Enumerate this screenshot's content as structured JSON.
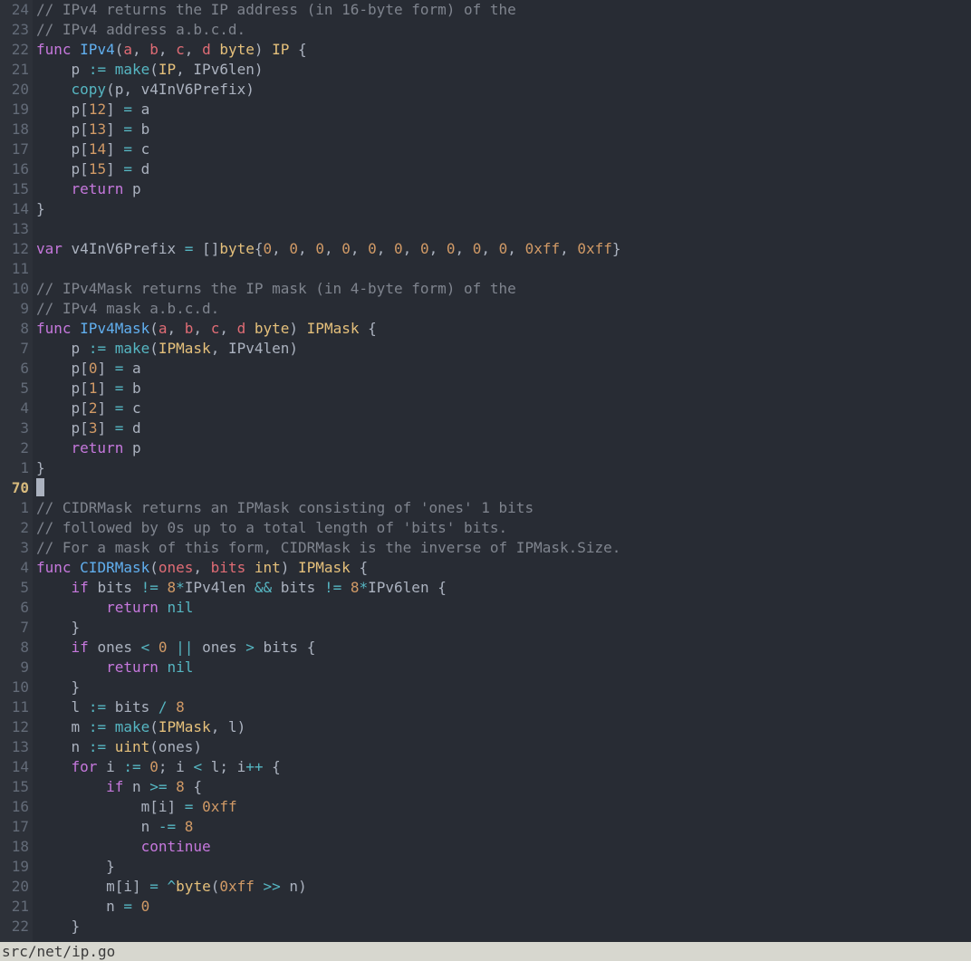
{
  "statusbar": {
    "path": "src/net/ip.go"
  },
  "vim": {
    "current_absolute_line": "70"
  },
  "gutter": [
    "24",
    "23",
    "22",
    "21",
    "20",
    "19",
    "18",
    "17",
    "16",
    "15",
    "14",
    "13",
    "12",
    "11",
    "10",
    "9",
    "8",
    "7",
    "6",
    "5",
    "4",
    "3",
    "2",
    "1",
    "70",
    "1",
    "2",
    "3",
    "4",
    "5",
    "6",
    "7",
    "8",
    "9",
    "10",
    "11",
    "12",
    "13",
    "14",
    "15",
    "16",
    "17",
    "18",
    "19",
    "20",
    "21",
    "22"
  ],
  "lines": [
    [
      {
        "c": "cmt",
        "t": "// IPv4 returns the IP address (in 16-byte form) of the"
      }
    ],
    [
      {
        "c": "cmt",
        "t": "// IPv4 address a.b.c.d."
      }
    ],
    [
      {
        "c": "kw",
        "t": "func"
      },
      {
        "c": "pun",
        "t": " "
      },
      {
        "c": "fn",
        "t": "IPv4"
      },
      {
        "c": "pun",
        "t": "("
      },
      {
        "c": "param",
        "t": "a"
      },
      {
        "c": "pun",
        "t": ", "
      },
      {
        "c": "param",
        "t": "b"
      },
      {
        "c": "pun",
        "t": ", "
      },
      {
        "c": "param",
        "t": "c"
      },
      {
        "c": "pun",
        "t": ", "
      },
      {
        "c": "param",
        "t": "d"
      },
      {
        "c": "pun",
        "t": " "
      },
      {
        "c": "typ",
        "t": "byte"
      },
      {
        "c": "pun",
        "t": ") "
      },
      {
        "c": "typ",
        "t": "IP"
      },
      {
        "c": "pun",
        "t": " {"
      }
    ],
    [
      {
        "c": "pun",
        "t": "    "
      },
      {
        "c": "ident",
        "t": "p"
      },
      {
        "c": "pun",
        "t": " "
      },
      {
        "c": "op",
        "t": ":="
      },
      {
        "c": "pun",
        "t": " "
      },
      {
        "c": "builtin",
        "t": "make"
      },
      {
        "c": "pun",
        "t": "("
      },
      {
        "c": "typ",
        "t": "IP"
      },
      {
        "c": "pun",
        "t": ", "
      },
      {
        "c": "ident",
        "t": "IPv6len"
      },
      {
        "c": "pun",
        "t": ")"
      }
    ],
    [
      {
        "c": "pun",
        "t": "    "
      },
      {
        "c": "builtin",
        "t": "copy"
      },
      {
        "c": "pun",
        "t": "("
      },
      {
        "c": "ident",
        "t": "p"
      },
      {
        "c": "pun",
        "t": ", "
      },
      {
        "c": "ident",
        "t": "v4InV6Prefix"
      },
      {
        "c": "pun",
        "t": ")"
      }
    ],
    [
      {
        "c": "pun",
        "t": "    "
      },
      {
        "c": "ident",
        "t": "p"
      },
      {
        "c": "pun",
        "t": "["
      },
      {
        "c": "num",
        "t": "12"
      },
      {
        "c": "pun",
        "t": "] "
      },
      {
        "c": "op",
        "t": "="
      },
      {
        "c": "pun",
        "t": " "
      },
      {
        "c": "ident",
        "t": "a"
      }
    ],
    [
      {
        "c": "pun",
        "t": "    "
      },
      {
        "c": "ident",
        "t": "p"
      },
      {
        "c": "pun",
        "t": "["
      },
      {
        "c": "num",
        "t": "13"
      },
      {
        "c": "pun",
        "t": "] "
      },
      {
        "c": "op",
        "t": "="
      },
      {
        "c": "pun",
        "t": " "
      },
      {
        "c": "ident",
        "t": "b"
      }
    ],
    [
      {
        "c": "pun",
        "t": "    "
      },
      {
        "c": "ident",
        "t": "p"
      },
      {
        "c": "pun",
        "t": "["
      },
      {
        "c": "num",
        "t": "14"
      },
      {
        "c": "pun",
        "t": "] "
      },
      {
        "c": "op",
        "t": "="
      },
      {
        "c": "pun",
        "t": " "
      },
      {
        "c": "ident",
        "t": "c"
      }
    ],
    [
      {
        "c": "pun",
        "t": "    "
      },
      {
        "c": "ident",
        "t": "p"
      },
      {
        "c": "pun",
        "t": "["
      },
      {
        "c": "num",
        "t": "15"
      },
      {
        "c": "pun",
        "t": "] "
      },
      {
        "c": "op",
        "t": "="
      },
      {
        "c": "pun",
        "t": " "
      },
      {
        "c": "ident",
        "t": "d"
      }
    ],
    [
      {
        "c": "pun",
        "t": "    "
      },
      {
        "c": "kw",
        "t": "return"
      },
      {
        "c": "pun",
        "t": " "
      },
      {
        "c": "ident",
        "t": "p"
      }
    ],
    [
      {
        "c": "pun",
        "t": "}"
      }
    ],
    [],
    [
      {
        "c": "kw",
        "t": "var"
      },
      {
        "c": "pun",
        "t": " "
      },
      {
        "c": "ident",
        "t": "v4InV6Prefix"
      },
      {
        "c": "pun",
        "t": " "
      },
      {
        "c": "op",
        "t": "="
      },
      {
        "c": "pun",
        "t": " []"
      },
      {
        "c": "typ",
        "t": "byte"
      },
      {
        "c": "pun",
        "t": "{"
      },
      {
        "c": "num",
        "t": "0"
      },
      {
        "c": "pun",
        "t": ", "
      },
      {
        "c": "num",
        "t": "0"
      },
      {
        "c": "pun",
        "t": ", "
      },
      {
        "c": "num",
        "t": "0"
      },
      {
        "c": "pun",
        "t": ", "
      },
      {
        "c": "num",
        "t": "0"
      },
      {
        "c": "pun",
        "t": ", "
      },
      {
        "c": "num",
        "t": "0"
      },
      {
        "c": "pun",
        "t": ", "
      },
      {
        "c": "num",
        "t": "0"
      },
      {
        "c": "pun",
        "t": ", "
      },
      {
        "c": "num",
        "t": "0"
      },
      {
        "c": "pun",
        "t": ", "
      },
      {
        "c": "num",
        "t": "0"
      },
      {
        "c": "pun",
        "t": ", "
      },
      {
        "c": "num",
        "t": "0"
      },
      {
        "c": "pun",
        "t": ", "
      },
      {
        "c": "num",
        "t": "0"
      },
      {
        "c": "pun",
        "t": ", "
      },
      {
        "c": "num",
        "t": "0xff"
      },
      {
        "c": "pun",
        "t": ", "
      },
      {
        "c": "num",
        "t": "0xff"
      },
      {
        "c": "pun",
        "t": "}"
      }
    ],
    [],
    [
      {
        "c": "cmt",
        "t": "// IPv4Mask returns the IP mask (in 4-byte form) of the"
      }
    ],
    [
      {
        "c": "cmt",
        "t": "// IPv4 mask a.b.c.d."
      }
    ],
    [
      {
        "c": "kw",
        "t": "func"
      },
      {
        "c": "pun",
        "t": " "
      },
      {
        "c": "fn",
        "t": "IPv4Mask"
      },
      {
        "c": "pun",
        "t": "("
      },
      {
        "c": "param",
        "t": "a"
      },
      {
        "c": "pun",
        "t": ", "
      },
      {
        "c": "param",
        "t": "b"
      },
      {
        "c": "pun",
        "t": ", "
      },
      {
        "c": "param",
        "t": "c"
      },
      {
        "c": "pun",
        "t": ", "
      },
      {
        "c": "param",
        "t": "d"
      },
      {
        "c": "pun",
        "t": " "
      },
      {
        "c": "typ",
        "t": "byte"
      },
      {
        "c": "pun",
        "t": ") "
      },
      {
        "c": "typ",
        "t": "IPMask"
      },
      {
        "c": "pun",
        "t": " {"
      }
    ],
    [
      {
        "c": "pun",
        "t": "    "
      },
      {
        "c": "ident",
        "t": "p"
      },
      {
        "c": "pun",
        "t": " "
      },
      {
        "c": "op",
        "t": ":="
      },
      {
        "c": "pun",
        "t": " "
      },
      {
        "c": "builtin",
        "t": "make"
      },
      {
        "c": "pun",
        "t": "("
      },
      {
        "c": "typ",
        "t": "IPMask"
      },
      {
        "c": "pun",
        "t": ", "
      },
      {
        "c": "ident",
        "t": "IPv4len"
      },
      {
        "c": "pun",
        "t": ")"
      }
    ],
    [
      {
        "c": "pun",
        "t": "    "
      },
      {
        "c": "ident",
        "t": "p"
      },
      {
        "c": "pun",
        "t": "["
      },
      {
        "c": "num",
        "t": "0"
      },
      {
        "c": "pun",
        "t": "] "
      },
      {
        "c": "op",
        "t": "="
      },
      {
        "c": "pun",
        "t": " "
      },
      {
        "c": "ident",
        "t": "a"
      }
    ],
    [
      {
        "c": "pun",
        "t": "    "
      },
      {
        "c": "ident",
        "t": "p"
      },
      {
        "c": "pun",
        "t": "["
      },
      {
        "c": "num",
        "t": "1"
      },
      {
        "c": "pun",
        "t": "] "
      },
      {
        "c": "op",
        "t": "="
      },
      {
        "c": "pun",
        "t": " "
      },
      {
        "c": "ident",
        "t": "b"
      }
    ],
    [
      {
        "c": "pun",
        "t": "    "
      },
      {
        "c": "ident",
        "t": "p"
      },
      {
        "c": "pun",
        "t": "["
      },
      {
        "c": "num",
        "t": "2"
      },
      {
        "c": "pun",
        "t": "] "
      },
      {
        "c": "op",
        "t": "="
      },
      {
        "c": "pun",
        "t": " "
      },
      {
        "c": "ident",
        "t": "c"
      }
    ],
    [
      {
        "c": "pun",
        "t": "    "
      },
      {
        "c": "ident",
        "t": "p"
      },
      {
        "c": "pun",
        "t": "["
      },
      {
        "c": "num",
        "t": "3"
      },
      {
        "c": "pun",
        "t": "] "
      },
      {
        "c": "op",
        "t": "="
      },
      {
        "c": "pun",
        "t": " "
      },
      {
        "c": "ident",
        "t": "d"
      }
    ],
    [
      {
        "c": "pun",
        "t": "    "
      },
      {
        "c": "kw",
        "t": "return"
      },
      {
        "c": "pun",
        "t": " "
      },
      {
        "c": "ident",
        "t": "p"
      }
    ],
    [
      {
        "c": "pun",
        "t": "}"
      }
    ],
    [
      {
        "c": "cursor",
        "t": ""
      }
    ],
    [
      {
        "c": "cmt",
        "t": "// CIDRMask returns an IPMask consisting of 'ones' 1 bits"
      }
    ],
    [
      {
        "c": "cmt",
        "t": "// followed by 0s up to a total length of 'bits' bits."
      }
    ],
    [
      {
        "c": "cmt",
        "t": "// For a mask of this form, CIDRMask is the inverse of IPMask.Size."
      }
    ],
    [
      {
        "c": "kw",
        "t": "func"
      },
      {
        "c": "pun",
        "t": " "
      },
      {
        "c": "fn",
        "t": "CIDRMask"
      },
      {
        "c": "pun",
        "t": "("
      },
      {
        "c": "param",
        "t": "ones"
      },
      {
        "c": "pun",
        "t": ", "
      },
      {
        "c": "param",
        "t": "bits"
      },
      {
        "c": "pun",
        "t": " "
      },
      {
        "c": "typ",
        "t": "int"
      },
      {
        "c": "pun",
        "t": ") "
      },
      {
        "c": "typ",
        "t": "IPMask"
      },
      {
        "c": "pun",
        "t": " {"
      }
    ],
    [
      {
        "c": "pun",
        "t": "    "
      },
      {
        "c": "kw",
        "t": "if"
      },
      {
        "c": "pun",
        "t": " "
      },
      {
        "c": "ident",
        "t": "bits"
      },
      {
        "c": "pun",
        "t": " "
      },
      {
        "c": "op",
        "t": "!="
      },
      {
        "c": "pun",
        "t": " "
      },
      {
        "c": "num",
        "t": "8"
      },
      {
        "c": "op",
        "t": "*"
      },
      {
        "c": "ident",
        "t": "IPv4len"
      },
      {
        "c": "pun",
        "t": " "
      },
      {
        "c": "op",
        "t": "&&"
      },
      {
        "c": "pun",
        "t": " "
      },
      {
        "c": "ident",
        "t": "bits"
      },
      {
        "c": "pun",
        "t": " "
      },
      {
        "c": "op",
        "t": "!="
      },
      {
        "c": "pun",
        "t": " "
      },
      {
        "c": "num",
        "t": "8"
      },
      {
        "c": "op",
        "t": "*"
      },
      {
        "c": "ident",
        "t": "IPv6len"
      },
      {
        "c": "pun",
        "t": " {"
      }
    ],
    [
      {
        "c": "pun",
        "t": "        "
      },
      {
        "c": "kw",
        "t": "return"
      },
      {
        "c": "pun",
        "t": " "
      },
      {
        "c": "builtin",
        "t": "nil"
      }
    ],
    [
      {
        "c": "pun",
        "t": "    }"
      }
    ],
    [
      {
        "c": "pun",
        "t": "    "
      },
      {
        "c": "kw",
        "t": "if"
      },
      {
        "c": "pun",
        "t": " "
      },
      {
        "c": "ident",
        "t": "ones"
      },
      {
        "c": "pun",
        "t": " "
      },
      {
        "c": "op",
        "t": "<"
      },
      {
        "c": "pun",
        "t": " "
      },
      {
        "c": "num",
        "t": "0"
      },
      {
        "c": "pun",
        "t": " "
      },
      {
        "c": "op",
        "t": "||"
      },
      {
        "c": "pun",
        "t": " "
      },
      {
        "c": "ident",
        "t": "ones"
      },
      {
        "c": "pun",
        "t": " "
      },
      {
        "c": "op",
        "t": ">"
      },
      {
        "c": "pun",
        "t": " "
      },
      {
        "c": "ident",
        "t": "bits"
      },
      {
        "c": "pun",
        "t": " {"
      }
    ],
    [
      {
        "c": "pun",
        "t": "        "
      },
      {
        "c": "kw",
        "t": "return"
      },
      {
        "c": "pun",
        "t": " "
      },
      {
        "c": "builtin",
        "t": "nil"
      }
    ],
    [
      {
        "c": "pun",
        "t": "    }"
      }
    ],
    [
      {
        "c": "pun",
        "t": "    "
      },
      {
        "c": "ident",
        "t": "l"
      },
      {
        "c": "pun",
        "t": " "
      },
      {
        "c": "op",
        "t": ":="
      },
      {
        "c": "pun",
        "t": " "
      },
      {
        "c": "ident",
        "t": "bits"
      },
      {
        "c": "pun",
        "t": " "
      },
      {
        "c": "op",
        "t": "/"
      },
      {
        "c": "pun",
        "t": " "
      },
      {
        "c": "num",
        "t": "8"
      }
    ],
    [
      {
        "c": "pun",
        "t": "    "
      },
      {
        "c": "ident",
        "t": "m"
      },
      {
        "c": "pun",
        "t": " "
      },
      {
        "c": "op",
        "t": ":="
      },
      {
        "c": "pun",
        "t": " "
      },
      {
        "c": "builtin",
        "t": "make"
      },
      {
        "c": "pun",
        "t": "("
      },
      {
        "c": "typ",
        "t": "IPMask"
      },
      {
        "c": "pun",
        "t": ", "
      },
      {
        "c": "ident",
        "t": "l"
      },
      {
        "c": "pun",
        "t": ")"
      }
    ],
    [
      {
        "c": "pun",
        "t": "    "
      },
      {
        "c": "ident",
        "t": "n"
      },
      {
        "c": "pun",
        "t": " "
      },
      {
        "c": "op",
        "t": ":="
      },
      {
        "c": "pun",
        "t": " "
      },
      {
        "c": "typ",
        "t": "uint"
      },
      {
        "c": "pun",
        "t": "("
      },
      {
        "c": "ident",
        "t": "ones"
      },
      {
        "c": "pun",
        "t": ")"
      }
    ],
    [
      {
        "c": "pun",
        "t": "    "
      },
      {
        "c": "kw",
        "t": "for"
      },
      {
        "c": "pun",
        "t": " "
      },
      {
        "c": "ident",
        "t": "i"
      },
      {
        "c": "pun",
        "t": " "
      },
      {
        "c": "op",
        "t": ":="
      },
      {
        "c": "pun",
        "t": " "
      },
      {
        "c": "num",
        "t": "0"
      },
      {
        "c": "pun",
        "t": "; "
      },
      {
        "c": "ident",
        "t": "i"
      },
      {
        "c": "pun",
        "t": " "
      },
      {
        "c": "op",
        "t": "<"
      },
      {
        "c": "pun",
        "t": " "
      },
      {
        "c": "ident",
        "t": "l"
      },
      {
        "c": "pun",
        "t": "; "
      },
      {
        "c": "ident",
        "t": "i"
      },
      {
        "c": "op",
        "t": "++"
      },
      {
        "c": "pun",
        "t": " {"
      }
    ],
    [
      {
        "c": "pun",
        "t": "        "
      },
      {
        "c": "kw",
        "t": "if"
      },
      {
        "c": "pun",
        "t": " "
      },
      {
        "c": "ident",
        "t": "n"
      },
      {
        "c": "pun",
        "t": " "
      },
      {
        "c": "op",
        "t": ">="
      },
      {
        "c": "pun",
        "t": " "
      },
      {
        "c": "num",
        "t": "8"
      },
      {
        "c": "pun",
        "t": " {"
      }
    ],
    [
      {
        "c": "pun",
        "t": "            "
      },
      {
        "c": "ident",
        "t": "m"
      },
      {
        "c": "pun",
        "t": "["
      },
      {
        "c": "ident",
        "t": "i"
      },
      {
        "c": "pun",
        "t": "] "
      },
      {
        "c": "op",
        "t": "="
      },
      {
        "c": "pun",
        "t": " "
      },
      {
        "c": "num",
        "t": "0xff"
      }
    ],
    [
      {
        "c": "pun",
        "t": "            "
      },
      {
        "c": "ident",
        "t": "n"
      },
      {
        "c": "pun",
        "t": " "
      },
      {
        "c": "op",
        "t": "-="
      },
      {
        "c": "pun",
        "t": " "
      },
      {
        "c": "num",
        "t": "8"
      }
    ],
    [
      {
        "c": "pun",
        "t": "            "
      },
      {
        "c": "kw",
        "t": "continue"
      }
    ],
    [
      {
        "c": "pun",
        "t": "        }"
      }
    ],
    [
      {
        "c": "pun",
        "t": "        "
      },
      {
        "c": "ident",
        "t": "m"
      },
      {
        "c": "pun",
        "t": "["
      },
      {
        "c": "ident",
        "t": "i"
      },
      {
        "c": "pun",
        "t": "] "
      },
      {
        "c": "op",
        "t": "="
      },
      {
        "c": "pun",
        "t": " "
      },
      {
        "c": "op",
        "t": "^"
      },
      {
        "c": "typ",
        "t": "byte"
      },
      {
        "c": "pun",
        "t": "("
      },
      {
        "c": "num",
        "t": "0xff"
      },
      {
        "c": "pun",
        "t": " "
      },
      {
        "c": "op",
        "t": ">>"
      },
      {
        "c": "pun",
        "t": " "
      },
      {
        "c": "ident",
        "t": "n"
      },
      {
        "c": "pun",
        "t": ")"
      }
    ],
    [
      {
        "c": "pun",
        "t": "        "
      },
      {
        "c": "ident",
        "t": "n"
      },
      {
        "c": "pun",
        "t": " "
      },
      {
        "c": "op",
        "t": "="
      },
      {
        "c": "pun",
        "t": " "
      },
      {
        "c": "num",
        "t": "0"
      }
    ],
    [
      {
        "c": "pun",
        "t": "    }"
      }
    ]
  ]
}
